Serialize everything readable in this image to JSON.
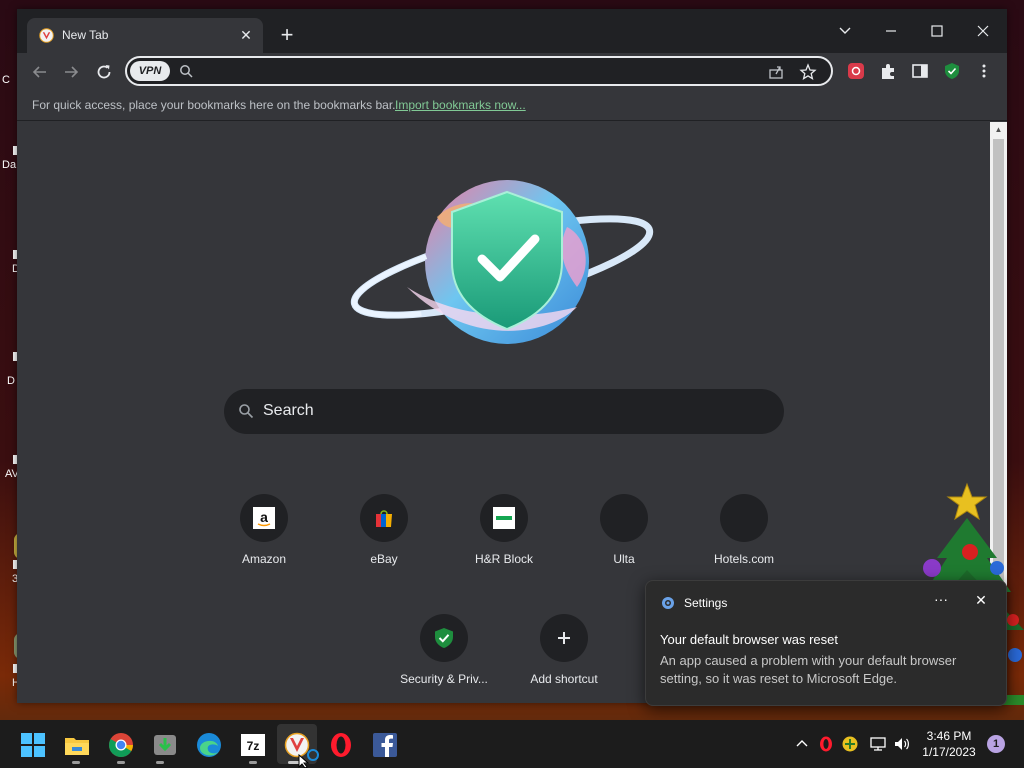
{
  "desktop": {
    "icons": [
      {
        "label": "C"
      },
      {
        "label": "Da"
      },
      {
        "label": "D"
      },
      {
        "label": "D"
      },
      {
        "label": "AV"
      },
      {
        "label": "3"
      },
      {
        "label": "H"
      }
    ]
  },
  "browser": {
    "tab": {
      "title": "New Tab",
      "close": "✕"
    },
    "new_tab_symbol": "+",
    "window_controls": {
      "dropdown": "⌄",
      "minimize": "—",
      "maximize": "☐",
      "close": "✕"
    },
    "omnibox": {
      "vpn_badge": "VPN",
      "value": ""
    },
    "bookmarks_bar": {
      "text": "For quick access, place your bookmarks here on the bookmarks bar.",
      "link": "Import bookmarks now..."
    },
    "search": {
      "label": "Search"
    },
    "shortcuts": [
      {
        "label": "Amazon",
        "icon": "amazon-icon"
      },
      {
        "label": "eBay",
        "icon": "ebay-icon"
      },
      {
        "label": "H&R Block",
        "icon": "hrblock-icon"
      },
      {
        "label": "Ulta",
        "icon": ""
      },
      {
        "label": "Hotels.com",
        "icon": ""
      },
      {
        "label": "Security & Priv...",
        "icon": "shield-icon"
      },
      {
        "label": "Add shortcut",
        "icon": "plus-icon"
      }
    ]
  },
  "notification": {
    "app": "Settings",
    "more": "···",
    "close": "✕",
    "title": "Your default browser was reset",
    "body": "An app caused a problem with your default browser setting, so it was reset to Microsoft Edge."
  },
  "taskbar": {
    "time": "3:46 PM",
    "date": "1/17/2023",
    "notification_count": "1"
  },
  "colors": {
    "chrome_dark": "#202124",
    "chrome_surface": "#35363a",
    "link_green": "#81c995",
    "shield_green": "#1e8e3e"
  }
}
